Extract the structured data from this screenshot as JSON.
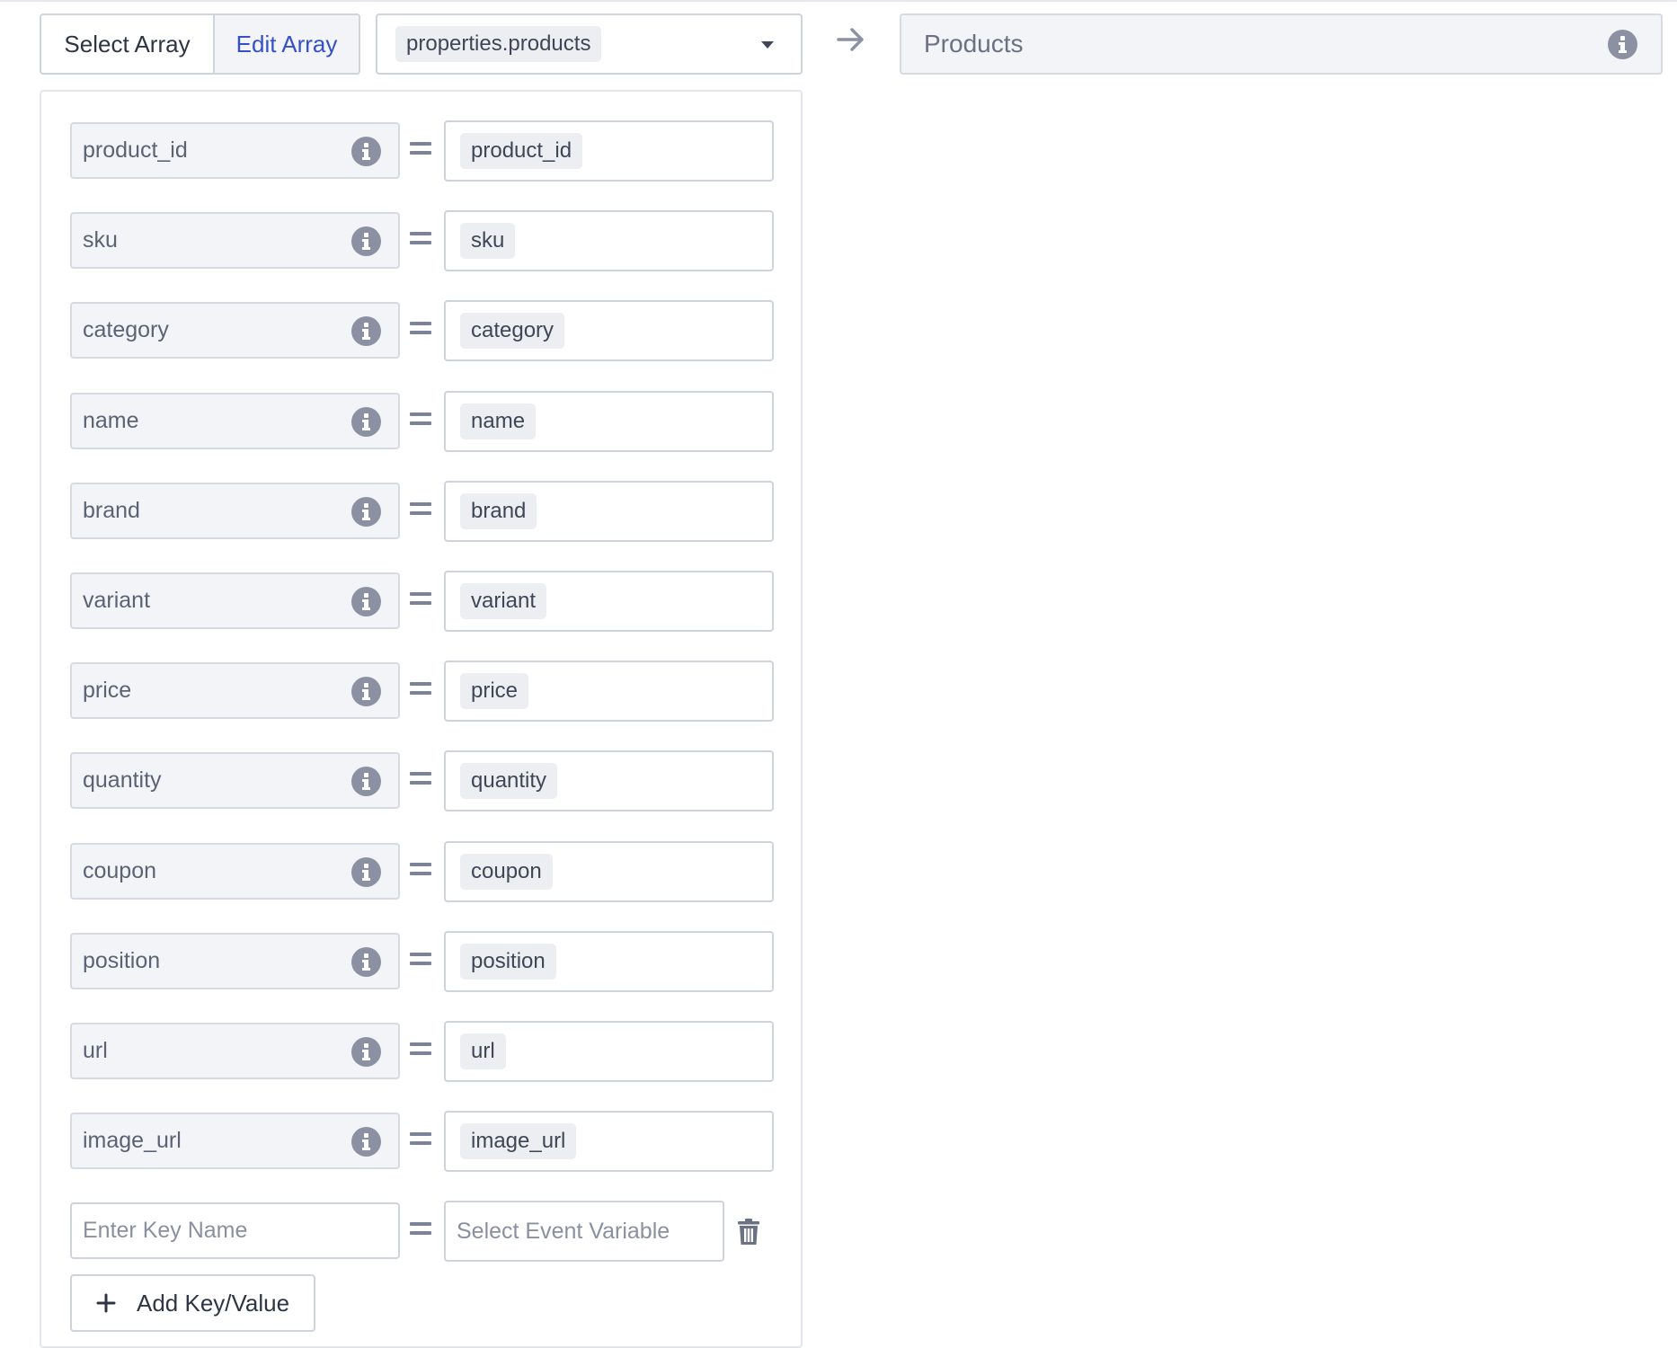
{
  "toolbar": {
    "select_array_label": "Select Array",
    "edit_array_label": "Edit Array",
    "array_path": "properties.products"
  },
  "target": {
    "value": "Products"
  },
  "mappings": [
    {
      "key": "product_id",
      "value": "product_id"
    },
    {
      "key": "sku",
      "value": "sku"
    },
    {
      "key": "category",
      "value": "category"
    },
    {
      "key": "name",
      "value": "name"
    },
    {
      "key": "brand",
      "value": "brand"
    },
    {
      "key": "variant",
      "value": "variant"
    },
    {
      "key": "price",
      "value": "price"
    },
    {
      "key": "quantity",
      "value": "quantity"
    },
    {
      "key": "coupon",
      "value": "coupon"
    },
    {
      "key": "position",
      "value": "position"
    },
    {
      "key": "url",
      "value": "url"
    },
    {
      "key": "image_url",
      "value": "image_url"
    }
  ],
  "new_row": {
    "key_placeholder": "Enter Key Name",
    "value_placeholder": "Select Event Variable"
  },
  "add_button_label": "Add Key/Value",
  "icons": {
    "info": "info-icon",
    "arrow": "arrow-right-icon",
    "caret": "chevron-down-icon",
    "trash": "trash-icon",
    "plus": "plus-icon"
  },
  "colors": {
    "accent": "#3451c7",
    "border": "#cfd3dc",
    "muted_bg": "#f3f4f7",
    "icon_gray": "#8b91a2"
  }
}
